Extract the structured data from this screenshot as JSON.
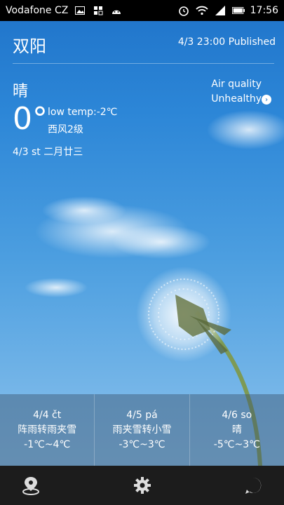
{
  "status_bar": {
    "carrier": "Vodafone CZ",
    "time": "17:56",
    "left_icons": [
      "image-icon",
      "apps-icon",
      "android-icon"
    ],
    "right_icons": [
      "alarm-icon",
      "wifi-icon",
      "signal-icon",
      "battery-icon"
    ]
  },
  "header": {
    "city": "双阳",
    "published": "4/3 23:00 Published"
  },
  "current": {
    "condition": "晴",
    "temperature": "0°",
    "low_temp": "low temp:-2℃",
    "wind": "西风2级",
    "date": "4/3 st 二月廿三"
  },
  "air_quality": {
    "label": "Air quality",
    "value": "Unhealthy"
  },
  "forecast": [
    {
      "date": "4/4 čt",
      "condition": "阵雨转雨夹雪",
      "temp": "-1℃~4℃"
    },
    {
      "date": "4/5 pá",
      "condition": "雨夹雪转小雪",
      "temp": "-3℃~3℃"
    },
    {
      "date": "4/6 so",
      "condition": "晴",
      "temp": "-5℃~3℃"
    }
  ],
  "bottom_bar": {
    "left_icon": "location-icon",
    "center_icon": "settings-gear-icon",
    "right_icon": "alert-icon"
  },
  "colors": {
    "sky_top": "#1f73c9",
    "sky_bottom": "#8fc3ea",
    "bottom_bar": "#1c1c1c",
    "status_bar": "#000000"
  }
}
